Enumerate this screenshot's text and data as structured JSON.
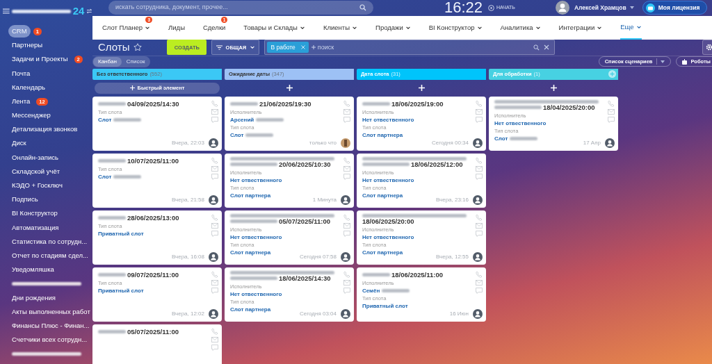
{
  "header": {
    "logo_suffix": "24",
    "search": {
      "placeholder": "искать сотрудника, документ, прочее..."
    },
    "clock": "16:22",
    "start_label": "НАЧАТЬ",
    "user": "Алексей Храмцов",
    "license": "Моя лицензия"
  },
  "sidebar": {
    "items": [
      {
        "label": "CRM",
        "selected": true,
        "badge": "1"
      },
      {
        "label": "Партнеры",
        "selected": false
      },
      {
        "label": "Задачи и Проекты",
        "selected": false,
        "badge": "2"
      },
      {
        "label": "Почта",
        "selected": false
      },
      {
        "label": "Календарь",
        "selected": false
      },
      {
        "label": "Лента",
        "selected": false,
        "badge": "12"
      },
      {
        "label": "Мессенджер",
        "selected": false
      },
      {
        "label": "Детализация звонков",
        "selected": false
      },
      {
        "label": "Диск",
        "selected": false
      },
      {
        "label": "Онлайн-запись",
        "selected": false
      },
      {
        "label": "Складской учёт",
        "selected": false
      },
      {
        "label": "КЭДО + Госключ",
        "selected": false
      },
      {
        "label": "Подпись",
        "selected": false
      },
      {
        "label": "BI Конструктор",
        "selected": false
      },
      {
        "label": "Автоматизация",
        "selected": false
      },
      {
        "label": "Статистика по сотрудн...",
        "selected": false
      },
      {
        "label": "Отчет по стадиям сдел...",
        "selected": false
      },
      {
        "label": "Уведомляшка",
        "selected": false
      },
      {
        "kind": "blurred",
        "selected": false
      },
      {
        "label": "Дни рождения",
        "selected": false
      },
      {
        "label": "Акты выполненных работ",
        "selected": false
      },
      {
        "label": "Финансы Плюс - Финан...",
        "selected": false
      },
      {
        "label": "Счетчики всех сотрудн...",
        "selected": false
      },
      {
        "kind": "blurred",
        "selected": false
      }
    ]
  },
  "nav": [
    {
      "label": "Слот Планер",
      "dropdown": true,
      "badge": "3",
      "selected": false
    },
    {
      "label": "Лиды",
      "dropdown": false,
      "selected": false
    },
    {
      "label": "Сделки",
      "dropdown": false,
      "badge": "1",
      "selected": false
    },
    {
      "label": "Товары и Склады",
      "dropdown": true,
      "selected": false
    },
    {
      "label": "Клиенты",
      "dropdown": true,
      "selected": false
    },
    {
      "label": "Продажи",
      "dropdown": true,
      "selected": false
    },
    {
      "label": "BI Конструктор",
      "dropdown": true,
      "selected": false
    },
    {
      "label": "Аналитика",
      "dropdown": true,
      "selected": false
    },
    {
      "label": "Интеграции",
      "dropdown": true,
      "selected": false
    },
    {
      "label": "Еще",
      "dropdown": true,
      "selected": true
    }
  ],
  "toolbar": {
    "title": "Слоты",
    "create": "СОЗДАТЬ",
    "filter": "ОБЩАЯ",
    "filter_tag": "В работе",
    "search_placeholder": "поиск"
  },
  "views": [
    {
      "label": "Канбан",
      "selected": true
    },
    {
      "label": "Список",
      "selected": false
    }
  ],
  "scenarios": "Список сценариев",
  "robots": "Роботы",
  "columns": [
    {
      "title": "Без ответственного",
      "count": "(552)",
      "color": "#3bc8f5",
      "dark_text": true,
      "quick_add": "Быстрый элемент",
      "cards": [
        {
          "prefix_blurred": true,
          "extra_line_blurred": false,
          "title": "04/09/2025/14:30",
          "fields": [
            {
              "label": "Тип слота",
              "value": "Слот",
              "blurred": true
            }
          ],
          "time": "Вчера, 22:03",
          "avatar_photo": false
        },
        {
          "prefix_blurred": true,
          "extra_line_blurred": false,
          "title": "10/07/2025/11:00",
          "fields": [
            {
              "label": "Тип слота",
              "value": "Слот",
              "blurred": true
            }
          ],
          "time": "Вчера, 21:58",
          "avatar_photo": false
        },
        {
          "prefix_blurred": true,
          "extra_line_blurred": false,
          "title": "28/06/2025/13:00",
          "fields": [
            {
              "label": "Тип слота",
              "value": "Приватный слот",
              "blurred": false
            }
          ],
          "time": "Вчера, 16:08",
          "avatar_photo": false
        },
        {
          "prefix_blurred": true,
          "extra_line_blurred": false,
          "title": "09/07/2025/11:00",
          "fields": [
            {
              "label": "Тип слота",
              "value": "Приватный слот",
              "blurred": false
            }
          ],
          "time": "Вчера, 12:02",
          "avatar_photo": false
        },
        {
          "prefix_blurred": true,
          "extra_line_blurred": false,
          "title": "05/07/2025/11:00"
        }
      ]
    },
    {
      "title": "Ожидание даты",
      "count": "(347)",
      "color": "#9dc1f5",
      "dark_text": true,
      "cards": [
        {
          "prefix_blurred": true,
          "extra_line_blurred": false,
          "title": "21/06/2025/19:30",
          "fields": [
            {
              "label": "Исполнитель",
              "value": "Арсений",
              "blurred": true
            },
            {
              "label": "Тип слота",
              "value": "Слот",
              "blurred": true
            }
          ],
          "time": "только что",
          "avatar_photo": true
        },
        {
          "prefix_blurred": true,
          "extra_line_blurred": true,
          "title": "20/06/2025/10:30",
          "fields": [
            {
              "label": "Исполнитель",
              "value": "Нет отвественного",
              "blurred": false
            },
            {
              "label": "Тип слота",
              "value": "Слот партнера",
              "blurred": false
            }
          ],
          "time": "1 Минута",
          "avatar_photo": false
        },
        {
          "prefix_blurred": true,
          "extra_line_blurred": true,
          "title": "05/07/2025/11:00",
          "fields": [
            {
              "label": "Исполнитель",
              "value": "Нет отвественного",
              "blurred": false
            },
            {
              "label": "Тип слота",
              "value": "Слот партнера",
              "blurred": false
            }
          ],
          "time": "Сегодня 07:58",
          "avatar_photo": false
        },
        {
          "prefix_blurred": true,
          "extra_line_blurred": true,
          "title": "18/06/2025/14:30",
          "fields": [
            {
              "label": "Исполнитель",
              "value": "Нет отвественного",
              "blurred": false
            },
            {
              "label": "Тип слота",
              "value": "Слот партнера",
              "blurred": false
            }
          ],
          "time": "Сегодня 03:04",
          "avatar_photo": false
        }
      ]
    },
    {
      "title": "Дата слота",
      "count": "(31)",
      "color": "#00c4fb",
      "dark_text": false,
      "cards": [
        {
          "prefix_blurred": true,
          "extra_line_blurred": false,
          "title": "18/06/2025/19:00",
          "fields": [
            {
              "label": "Исполнитель",
              "value": "Нет отвественного",
              "blurred": false
            },
            {
              "label": "Тип слота",
              "value": "Слот партнера",
              "blurred": false
            }
          ],
          "time": "Сегодня 00:34",
          "avatar_photo": false
        },
        {
          "prefix_blurred": true,
          "extra_line_blurred": true,
          "title": "18/06/2025/12:00",
          "fields": [
            {
              "label": "Исполнитель",
              "value": "Нет отвественного",
              "blurred": false
            },
            {
              "label": "Тип слота",
              "value": "Слот партнера",
              "blurred": false
            }
          ],
          "time": "Вчера, 23:16",
          "avatar_photo": false
        },
        {
          "prefix_blurred": false,
          "extra_line_blurred": true,
          "title": "18/06/2025/20:00",
          "fields": [
            {
              "label": "Исполнитель",
              "value": "Нет отвественного",
              "blurred": false
            },
            {
              "label": "Тип слота",
              "value": "Слот партнера",
              "blurred": false
            }
          ],
          "time": "Вчера, 12:55",
          "avatar_photo": false
        },
        {
          "prefix_blurred": true,
          "extra_line_blurred": false,
          "title": "18/06/2025/11:00",
          "fields": [
            {
              "label": "Исполнитель",
              "value": "Семён",
              "blurred": true
            },
            {
              "label": "Тип слота",
              "value": "Приватный слот",
              "blurred": false
            }
          ],
          "time": "16 Июн",
          "avatar_photo": false
        }
      ]
    },
    {
      "title": "Для обработки",
      "count": "(1)",
      "color": "#47d1e2",
      "dark_text": false,
      "add_stage": true,
      "cards": [
        {
          "prefix_blurred": true,
          "extra_line_blurred": true,
          "title": "18/04/2025/20:00",
          "fields": [
            {
              "label": "Исполнитель",
              "value": "Нет отвественного",
              "blurred": false
            },
            {
              "label": "Тип слота",
              "value": "Слот",
              "blurred": true
            }
          ],
          "time": "17 Апр",
          "avatar_photo": false
        }
      ]
    }
  ]
}
